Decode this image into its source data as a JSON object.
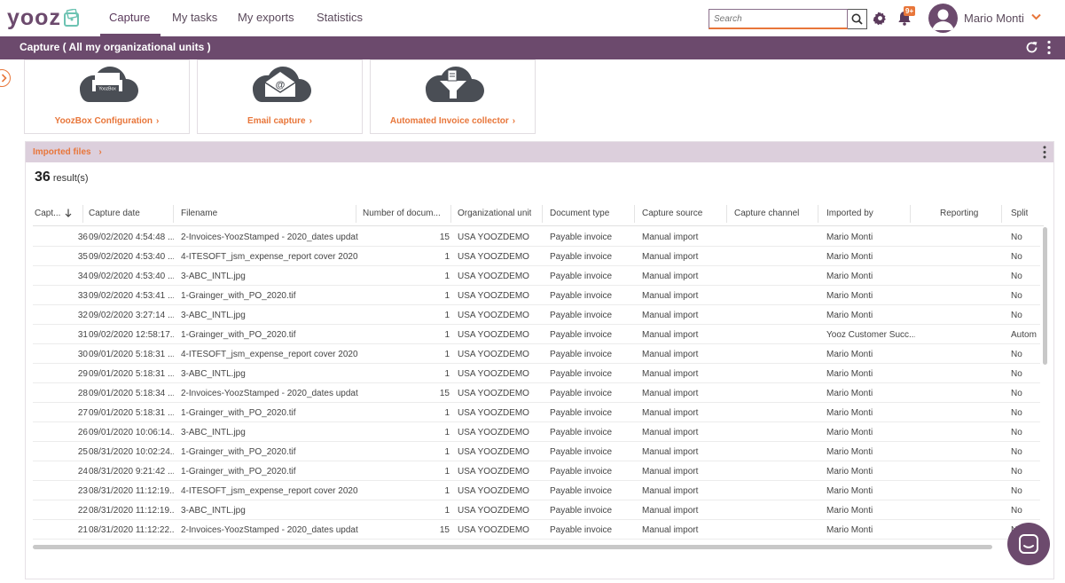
{
  "app": {
    "logo_text": "yooz"
  },
  "nav": {
    "tabs": [
      {
        "label": "Capture"
      },
      {
        "label": "My tasks"
      },
      {
        "label": "My exports"
      },
      {
        "label": "Statistics"
      }
    ],
    "search_placeholder": "Search",
    "notifications_badge": "9+",
    "user_name": "Mario Monti"
  },
  "section": {
    "title": "Capture ( All my organizational units )"
  },
  "cards": [
    {
      "label": "YoozBox Configuration",
      "icon_text": "YoozBox"
    },
    {
      "label": "Email capture"
    },
    {
      "label": "Automated Invoice collector"
    }
  ],
  "panel": {
    "title": "Imported files",
    "results_count": "36",
    "results_label": "result(s)"
  },
  "columns": [
    "Capt...",
    "Capture date",
    "Filename",
    "Number of docum...",
    "Organizational unit",
    "Document type",
    "Capture source",
    "Capture channel",
    "Imported by",
    "Reporting",
    "Split"
  ],
  "rows": [
    {
      "id": "36",
      "date": "09/02/2020 4:54:48 ...",
      "file": "2-Invoices-YoozStamped - 2020_dates updat...",
      "num": "15",
      "org": "USA YOOZDEMO",
      "type": "Payable invoice",
      "source": "Manual import",
      "channel": "",
      "by": "Mario Monti",
      "reporting": "",
      "split": "No"
    },
    {
      "id": "35",
      "date": "09/02/2020 4:53:40 ...",
      "file": "4-ITESOFT_jsm_expense_report cover 2020....",
      "num": "1",
      "org": "USA YOOZDEMO",
      "type": "Payable invoice",
      "source": "Manual import",
      "channel": "",
      "by": "Mario Monti",
      "reporting": "",
      "split": "No"
    },
    {
      "id": "34",
      "date": "09/02/2020 4:53:40 ...",
      "file": "3-ABC_INTL.jpg",
      "num": "1",
      "org": "USA YOOZDEMO",
      "type": "Payable invoice",
      "source": "Manual import",
      "channel": "",
      "by": "Mario Monti",
      "reporting": "",
      "split": "No"
    },
    {
      "id": "33",
      "date": "09/02/2020 4:53:41 ...",
      "file": "1-Grainger_with_PO_2020.tif",
      "num": "1",
      "org": "USA YOOZDEMO",
      "type": "Payable invoice",
      "source": "Manual import",
      "channel": "",
      "by": "Mario Monti",
      "reporting": "",
      "split": "No"
    },
    {
      "id": "32",
      "date": "09/02/2020 3:27:14 ...",
      "file": "3-ABC_INTL.jpg",
      "num": "1",
      "org": "USA YOOZDEMO",
      "type": "Payable invoice",
      "source": "Manual import",
      "channel": "",
      "by": "Mario Monti",
      "reporting": "",
      "split": "No"
    },
    {
      "id": "31",
      "date": "09/02/2020 12:58:17...",
      "file": "1-Grainger_with_PO_2020.tif",
      "num": "1",
      "org": "USA YOOZDEMO",
      "type": "Payable invoice",
      "source": "Manual import",
      "channel": "",
      "by": "Yooz Customer Succ...",
      "reporting": "",
      "split": "Autom"
    },
    {
      "id": "30",
      "date": "09/01/2020 5:18:31 ...",
      "file": "4-ITESOFT_jsm_expense_report cover 2020....",
      "num": "1",
      "org": "USA YOOZDEMO",
      "type": "Payable invoice",
      "source": "Manual import",
      "channel": "",
      "by": "Mario Monti",
      "reporting": "",
      "split": "No"
    },
    {
      "id": "29",
      "date": "09/01/2020 5:18:31 ...",
      "file": "3-ABC_INTL.jpg",
      "num": "1",
      "org": "USA YOOZDEMO",
      "type": "Payable invoice",
      "source": "Manual import",
      "channel": "",
      "by": "Mario Monti",
      "reporting": "",
      "split": "No"
    },
    {
      "id": "28",
      "date": "09/01/2020 5:18:34 ...",
      "file": "2-Invoices-YoozStamped - 2020_dates updat...",
      "num": "15",
      "org": "USA YOOZDEMO",
      "type": "Payable invoice",
      "source": "Manual import",
      "channel": "",
      "by": "Mario Monti",
      "reporting": "",
      "split": "No"
    },
    {
      "id": "27",
      "date": "09/01/2020 5:18:31 ...",
      "file": "1-Grainger_with_PO_2020.tif",
      "num": "1",
      "org": "USA YOOZDEMO",
      "type": "Payable invoice",
      "source": "Manual import",
      "channel": "",
      "by": "Mario Monti",
      "reporting": "",
      "split": "No"
    },
    {
      "id": "26",
      "date": "09/01/2020 10:06:14...",
      "file": "3-ABC_INTL.jpg",
      "num": "1",
      "org": "USA YOOZDEMO",
      "type": "Payable invoice",
      "source": "Manual import",
      "channel": "",
      "by": "Mario Monti",
      "reporting": "",
      "split": "No"
    },
    {
      "id": "25",
      "date": "08/31/2020 10:02:24...",
      "file": "1-Grainger_with_PO_2020.tif",
      "num": "1",
      "org": "USA YOOZDEMO",
      "type": "Payable invoice",
      "source": "Manual import",
      "channel": "",
      "by": "Mario Monti",
      "reporting": "",
      "split": "No"
    },
    {
      "id": "24",
      "date": "08/31/2020 9:21:42 ...",
      "file": "1-Grainger_with_PO_2020.tif",
      "num": "1",
      "org": "USA YOOZDEMO",
      "type": "Payable invoice",
      "source": "Manual import",
      "channel": "",
      "by": "Mario Monti",
      "reporting": "",
      "split": "No"
    },
    {
      "id": "23",
      "date": "08/31/2020 11:12:19...",
      "file": "4-ITESOFT_jsm_expense_report cover 2020....",
      "num": "1",
      "org": "USA YOOZDEMO",
      "type": "Payable invoice",
      "source": "Manual import",
      "channel": "",
      "by": "Mario Monti",
      "reporting": "",
      "split": "No"
    },
    {
      "id": "22",
      "date": "08/31/2020 11:12:19...",
      "file": "3-ABC_INTL.jpg",
      "num": "1",
      "org": "USA YOOZDEMO",
      "type": "Payable invoice",
      "source": "Manual import",
      "channel": "",
      "by": "Mario Monti",
      "reporting": "",
      "split": "No"
    },
    {
      "id": "21",
      "date": "08/31/2020 11:12:22...",
      "file": "2-Invoices-YoozStamped - 2020_dates updat...",
      "num": "15",
      "org": "USA YOOZDEMO",
      "type": "Payable invoice",
      "source": "Manual import",
      "channel": "",
      "by": "Mario Monti",
      "reporting": "",
      "split": "No"
    }
  ],
  "colors": {
    "brand_purple": "#6c4a6d",
    "accent_orange": "#e8763a",
    "panel_header": "#dccfdc"
  }
}
